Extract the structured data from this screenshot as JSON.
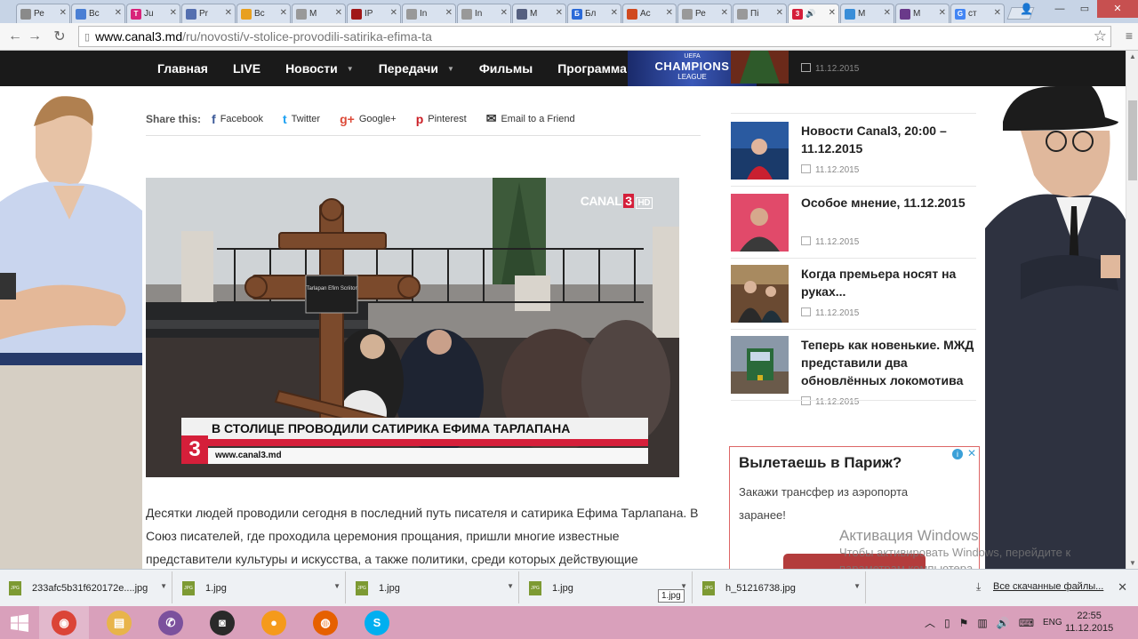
{
  "browser": {
    "tabs": [
      {
        "label": "Ре",
        "color": "#8a8a8a",
        "glyph": ""
      },
      {
        "label": "Вс",
        "color": "#4a7fd4",
        "glyph": ""
      },
      {
        "label": "Ju",
        "color": "#d8237a",
        "glyph": "T"
      },
      {
        "label": "Pr",
        "color": "#5570b0",
        "glyph": ""
      },
      {
        "label": "Вс",
        "color": "#e8a020",
        "glyph": ""
      },
      {
        "label": "M",
        "color": "#999999",
        "glyph": ""
      },
      {
        "label": "IP",
        "color": "#a01818",
        "glyph": ""
      },
      {
        "label": "In",
        "color": "#999999",
        "glyph": ""
      },
      {
        "label": "In",
        "color": "#999999",
        "glyph": ""
      },
      {
        "label": "M",
        "color": "#556080",
        "glyph": ""
      },
      {
        "label": "Бл",
        "color": "#2b6ad8",
        "glyph": "Б"
      },
      {
        "label": "Ас",
        "color": "#d04a20",
        "glyph": ""
      },
      {
        "label": "Ре",
        "color": "#999999",
        "glyph": ""
      },
      {
        "label": "Пі",
        "color": "#999999",
        "glyph": ""
      },
      {
        "label": "",
        "color": "#d51f3a",
        "glyph": "3",
        "active": true
      },
      {
        "label": "M",
        "color": "#3a8ed8",
        "glyph": ""
      },
      {
        "label": "M",
        "color": "#6a3a8a",
        "glyph": ""
      },
      {
        "label": "ст",
        "color": "#4285f4",
        "glyph": "G"
      }
    ],
    "url_host": "www.canal3.md",
    "url_path": "/ru/novosti/v-stolice-provodili-satirika-efima-ta"
  },
  "site": {
    "nav": [
      {
        "label": "Главная",
        "caret": false
      },
      {
        "label": "LIVE",
        "caret": false
      },
      {
        "label": "Новости",
        "caret": true
      },
      {
        "label": "Передачи",
        "caret": true
      },
      {
        "label": "Фильмы",
        "caret": false
      },
      {
        "label": "Программа",
        "caret": false
      }
    ],
    "ucl": {
      "top": "UEFA",
      "main": "CHAMPIONS",
      "sub": "LEAGUE"
    }
  },
  "share": {
    "label": "Share this:",
    "items": [
      {
        "icon": "f",
        "label": "Facebook",
        "color": "#3b5998",
        "name": "facebook"
      },
      {
        "icon": "t",
        "label": "Twitter",
        "color": "#1da1f2",
        "name": "twitter"
      },
      {
        "icon": "g+",
        "label": "Google+",
        "color": "#dd4b39",
        "name": "google-plus"
      },
      {
        "icon": "p",
        "label": "Pinterest",
        "color": "#cb2027",
        "name": "pinterest"
      },
      {
        "icon": "✉",
        "label": "Email to a Friend",
        "color": "#333333",
        "name": "email"
      }
    ]
  },
  "video": {
    "headline": "В СТОЛИЦЕ ПРОВОДИЛИ САТИРИКА ЕФИМА ТАРЛАПАНА",
    "url": "www.canal3.md",
    "logo_text": "CANAL",
    "logo_num": "3",
    "logo_hd": "HD",
    "badge": "3",
    "plaque": "Tarlapan Efim Scriitor"
  },
  "article": {
    "text": "Десятки людей проводили сегодня в последний путь писателя и сатирика Ефима Тарлапана. В Союз писателей, где проходила церемония прощания, пришли многие известные представители культуры и искусства, а также политики, среди которых действующие"
  },
  "sidebar": {
    "news": [
      {
        "title": "",
        "date": "11.12.2015",
        "thumb": "tree"
      },
      {
        "title": "Новости Canal3, 20:00 – 11.12.2015",
        "date": "11.12.2015",
        "thumb": "anchor"
      },
      {
        "title": "Особое мнение, 11.12.2015",
        "date": "11.12.2015",
        "thumb": "guest"
      },
      {
        "title": "Когда премьера носят на руках...",
        "date": "11.12.2015",
        "thumb": "parliament"
      },
      {
        "title": "Теперь как новенькие. МЖД представили два обновлённых локомотива",
        "date": "11.12.2015",
        "thumb": "train"
      }
    ],
    "ad": {
      "title": "Вылетаешь в Париж?",
      "text": "Закажи трансфер из аэропорта заранее!"
    }
  },
  "watermark": {
    "title": "Активация Windows",
    "text": "Чтобы активировать Windows, перейдите к параметрам компьютера."
  },
  "downloads": {
    "items": [
      {
        "name": "233afc5b31f620172e....jpg"
      },
      {
        "name": "1.jpg"
      },
      {
        "name": "1.jpg"
      },
      {
        "name": "1.jpg"
      },
      {
        "name": "h_51216738.jpg"
      }
    ],
    "tooltip": "1.jpg",
    "all_label": "Все скачанные файлы..."
  },
  "taskbar": {
    "apps": [
      {
        "name": "chrome",
        "color": "#db4437",
        "glyph": "◉",
        "active": true
      },
      {
        "name": "explorer",
        "color": "#e8b44a",
        "glyph": "▤"
      },
      {
        "name": "viber",
        "color": "#7b519d",
        "glyph": "✆"
      },
      {
        "name": "camera",
        "color": "#2a2a2a",
        "glyph": "◙"
      },
      {
        "name": "orange-app",
        "color": "#f59a1b",
        "glyph": "●"
      },
      {
        "name": "firefox",
        "color": "#e66000",
        "glyph": "◍"
      },
      {
        "name": "skype",
        "color": "#00aff0",
        "glyph": "S"
      }
    ],
    "lang": "ENG",
    "time": "22:55",
    "date": "11.12.2015"
  }
}
